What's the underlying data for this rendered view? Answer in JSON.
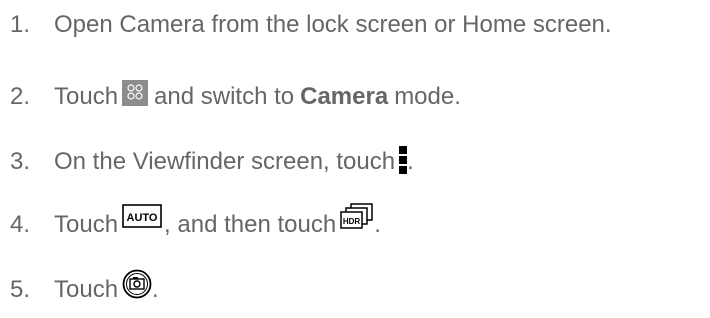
{
  "steps": [
    {
      "number": "1.",
      "text": "Open Camera from the lock screen or Home screen."
    },
    {
      "number": "2.",
      "text_before": "Touch",
      "icon": "mode-grid-icon",
      "text_after_1": "and switch to",
      "bold": "Camera",
      "text_after_2": "mode."
    },
    {
      "number": "3.",
      "text_before": "On the Viewfinder screen, touch",
      "icon": "menu-icon",
      "text_after": "."
    },
    {
      "number": "4.",
      "text_before": "Touch",
      "icon_1": "auto-icon",
      "icon_1_label": "AUTO",
      "text_middle": ", and then touch",
      "icon_2": "hdr-icon",
      "icon_2_label": "HDR",
      "text_after": "."
    },
    {
      "number": "5.",
      "text_before": "Touch",
      "icon": "shutter-icon",
      "text_after": "."
    }
  ]
}
